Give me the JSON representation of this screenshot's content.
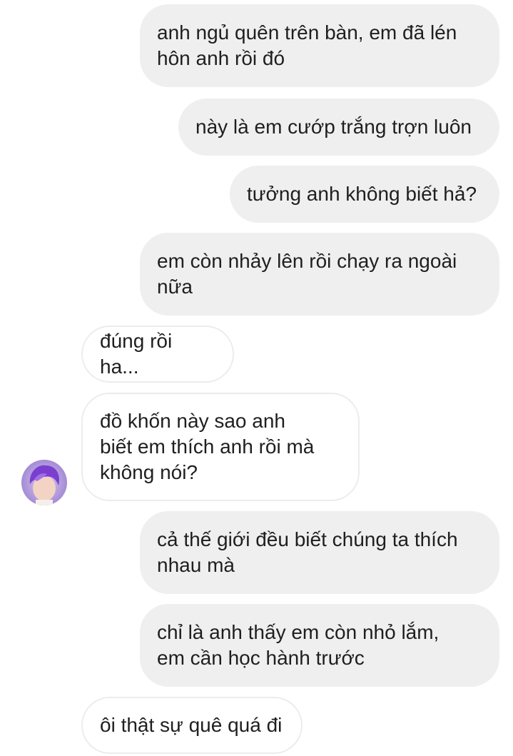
{
  "conversation": {
    "messages": [
      {
        "sender": "me",
        "text": "anh ngủ quên trên bàn, em đã lén\nhôn anh rồi đó"
      },
      {
        "sender": "me",
        "text": "này là em cướp trắng trợn luôn"
      },
      {
        "sender": "me",
        "text": "tưởng anh không biết hả?"
      },
      {
        "sender": "me",
        "text": "em còn nhảy lên rồi chạy ra ngoài\nnữa"
      },
      {
        "sender": "other",
        "text": "đúng rồi ha..."
      },
      {
        "sender": "other",
        "text": "đồ khốn này sao anh\nbiết em thích anh rồi mà\nkhông nói?"
      },
      {
        "sender": "me",
        "text": "cả thế giới đều biết chúng ta thích\nnhau mà"
      },
      {
        "sender": "me",
        "text": "chỉ là anh thấy em còn nhỏ lắm,\nem cần học hành trước"
      },
      {
        "sender": "other",
        "text": "ôi thật sự quê quá đi"
      }
    ]
  },
  "colors": {
    "sent_bubble": "#efefef",
    "received_border": "#ececec",
    "text": "#1f1f1f",
    "avatar_hair": "#7b3fd0"
  },
  "icons": {
    "avatar": "contact-avatar-icon"
  }
}
